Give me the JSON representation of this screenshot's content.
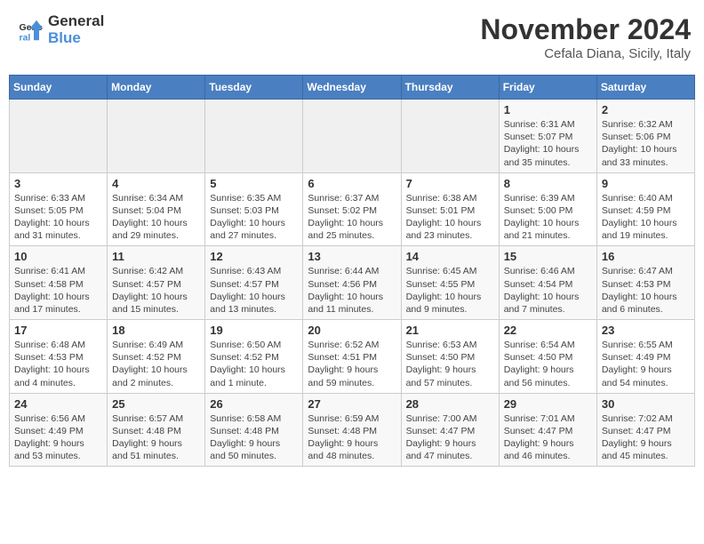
{
  "header": {
    "logo_line1": "General",
    "logo_line2": "Blue",
    "month_title": "November 2024",
    "subtitle": "Cefala Diana, Sicily, Italy"
  },
  "weekdays": [
    "Sunday",
    "Monday",
    "Tuesday",
    "Wednesday",
    "Thursday",
    "Friday",
    "Saturday"
  ],
  "weeks": [
    [
      {
        "day": "",
        "info": ""
      },
      {
        "day": "",
        "info": ""
      },
      {
        "day": "",
        "info": ""
      },
      {
        "day": "",
        "info": ""
      },
      {
        "day": "",
        "info": ""
      },
      {
        "day": "1",
        "info": "Sunrise: 6:31 AM\nSunset: 5:07 PM\nDaylight: 10 hours and 35 minutes."
      },
      {
        "day": "2",
        "info": "Sunrise: 6:32 AM\nSunset: 5:06 PM\nDaylight: 10 hours and 33 minutes."
      }
    ],
    [
      {
        "day": "3",
        "info": "Sunrise: 6:33 AM\nSunset: 5:05 PM\nDaylight: 10 hours and 31 minutes."
      },
      {
        "day": "4",
        "info": "Sunrise: 6:34 AM\nSunset: 5:04 PM\nDaylight: 10 hours and 29 minutes."
      },
      {
        "day": "5",
        "info": "Sunrise: 6:35 AM\nSunset: 5:03 PM\nDaylight: 10 hours and 27 minutes."
      },
      {
        "day": "6",
        "info": "Sunrise: 6:37 AM\nSunset: 5:02 PM\nDaylight: 10 hours and 25 minutes."
      },
      {
        "day": "7",
        "info": "Sunrise: 6:38 AM\nSunset: 5:01 PM\nDaylight: 10 hours and 23 minutes."
      },
      {
        "day": "8",
        "info": "Sunrise: 6:39 AM\nSunset: 5:00 PM\nDaylight: 10 hours and 21 minutes."
      },
      {
        "day": "9",
        "info": "Sunrise: 6:40 AM\nSunset: 4:59 PM\nDaylight: 10 hours and 19 minutes."
      }
    ],
    [
      {
        "day": "10",
        "info": "Sunrise: 6:41 AM\nSunset: 4:58 PM\nDaylight: 10 hours and 17 minutes."
      },
      {
        "day": "11",
        "info": "Sunrise: 6:42 AM\nSunset: 4:57 PM\nDaylight: 10 hours and 15 minutes."
      },
      {
        "day": "12",
        "info": "Sunrise: 6:43 AM\nSunset: 4:57 PM\nDaylight: 10 hours and 13 minutes."
      },
      {
        "day": "13",
        "info": "Sunrise: 6:44 AM\nSunset: 4:56 PM\nDaylight: 10 hours and 11 minutes."
      },
      {
        "day": "14",
        "info": "Sunrise: 6:45 AM\nSunset: 4:55 PM\nDaylight: 10 hours and 9 minutes."
      },
      {
        "day": "15",
        "info": "Sunrise: 6:46 AM\nSunset: 4:54 PM\nDaylight: 10 hours and 7 minutes."
      },
      {
        "day": "16",
        "info": "Sunrise: 6:47 AM\nSunset: 4:53 PM\nDaylight: 10 hours and 6 minutes."
      }
    ],
    [
      {
        "day": "17",
        "info": "Sunrise: 6:48 AM\nSunset: 4:53 PM\nDaylight: 10 hours and 4 minutes."
      },
      {
        "day": "18",
        "info": "Sunrise: 6:49 AM\nSunset: 4:52 PM\nDaylight: 10 hours and 2 minutes."
      },
      {
        "day": "19",
        "info": "Sunrise: 6:50 AM\nSunset: 4:52 PM\nDaylight: 10 hours and 1 minute."
      },
      {
        "day": "20",
        "info": "Sunrise: 6:52 AM\nSunset: 4:51 PM\nDaylight: 9 hours and 59 minutes."
      },
      {
        "day": "21",
        "info": "Sunrise: 6:53 AM\nSunset: 4:50 PM\nDaylight: 9 hours and 57 minutes."
      },
      {
        "day": "22",
        "info": "Sunrise: 6:54 AM\nSunset: 4:50 PM\nDaylight: 9 hours and 56 minutes."
      },
      {
        "day": "23",
        "info": "Sunrise: 6:55 AM\nSunset: 4:49 PM\nDaylight: 9 hours and 54 minutes."
      }
    ],
    [
      {
        "day": "24",
        "info": "Sunrise: 6:56 AM\nSunset: 4:49 PM\nDaylight: 9 hours and 53 minutes."
      },
      {
        "day": "25",
        "info": "Sunrise: 6:57 AM\nSunset: 4:48 PM\nDaylight: 9 hours and 51 minutes."
      },
      {
        "day": "26",
        "info": "Sunrise: 6:58 AM\nSunset: 4:48 PM\nDaylight: 9 hours and 50 minutes."
      },
      {
        "day": "27",
        "info": "Sunrise: 6:59 AM\nSunset: 4:48 PM\nDaylight: 9 hours and 48 minutes."
      },
      {
        "day": "28",
        "info": "Sunrise: 7:00 AM\nSunset: 4:47 PM\nDaylight: 9 hours and 47 minutes."
      },
      {
        "day": "29",
        "info": "Sunrise: 7:01 AM\nSunset: 4:47 PM\nDaylight: 9 hours and 46 minutes."
      },
      {
        "day": "30",
        "info": "Sunrise: 7:02 AM\nSunset: 4:47 PM\nDaylight: 9 hours and 45 minutes."
      }
    ]
  ]
}
